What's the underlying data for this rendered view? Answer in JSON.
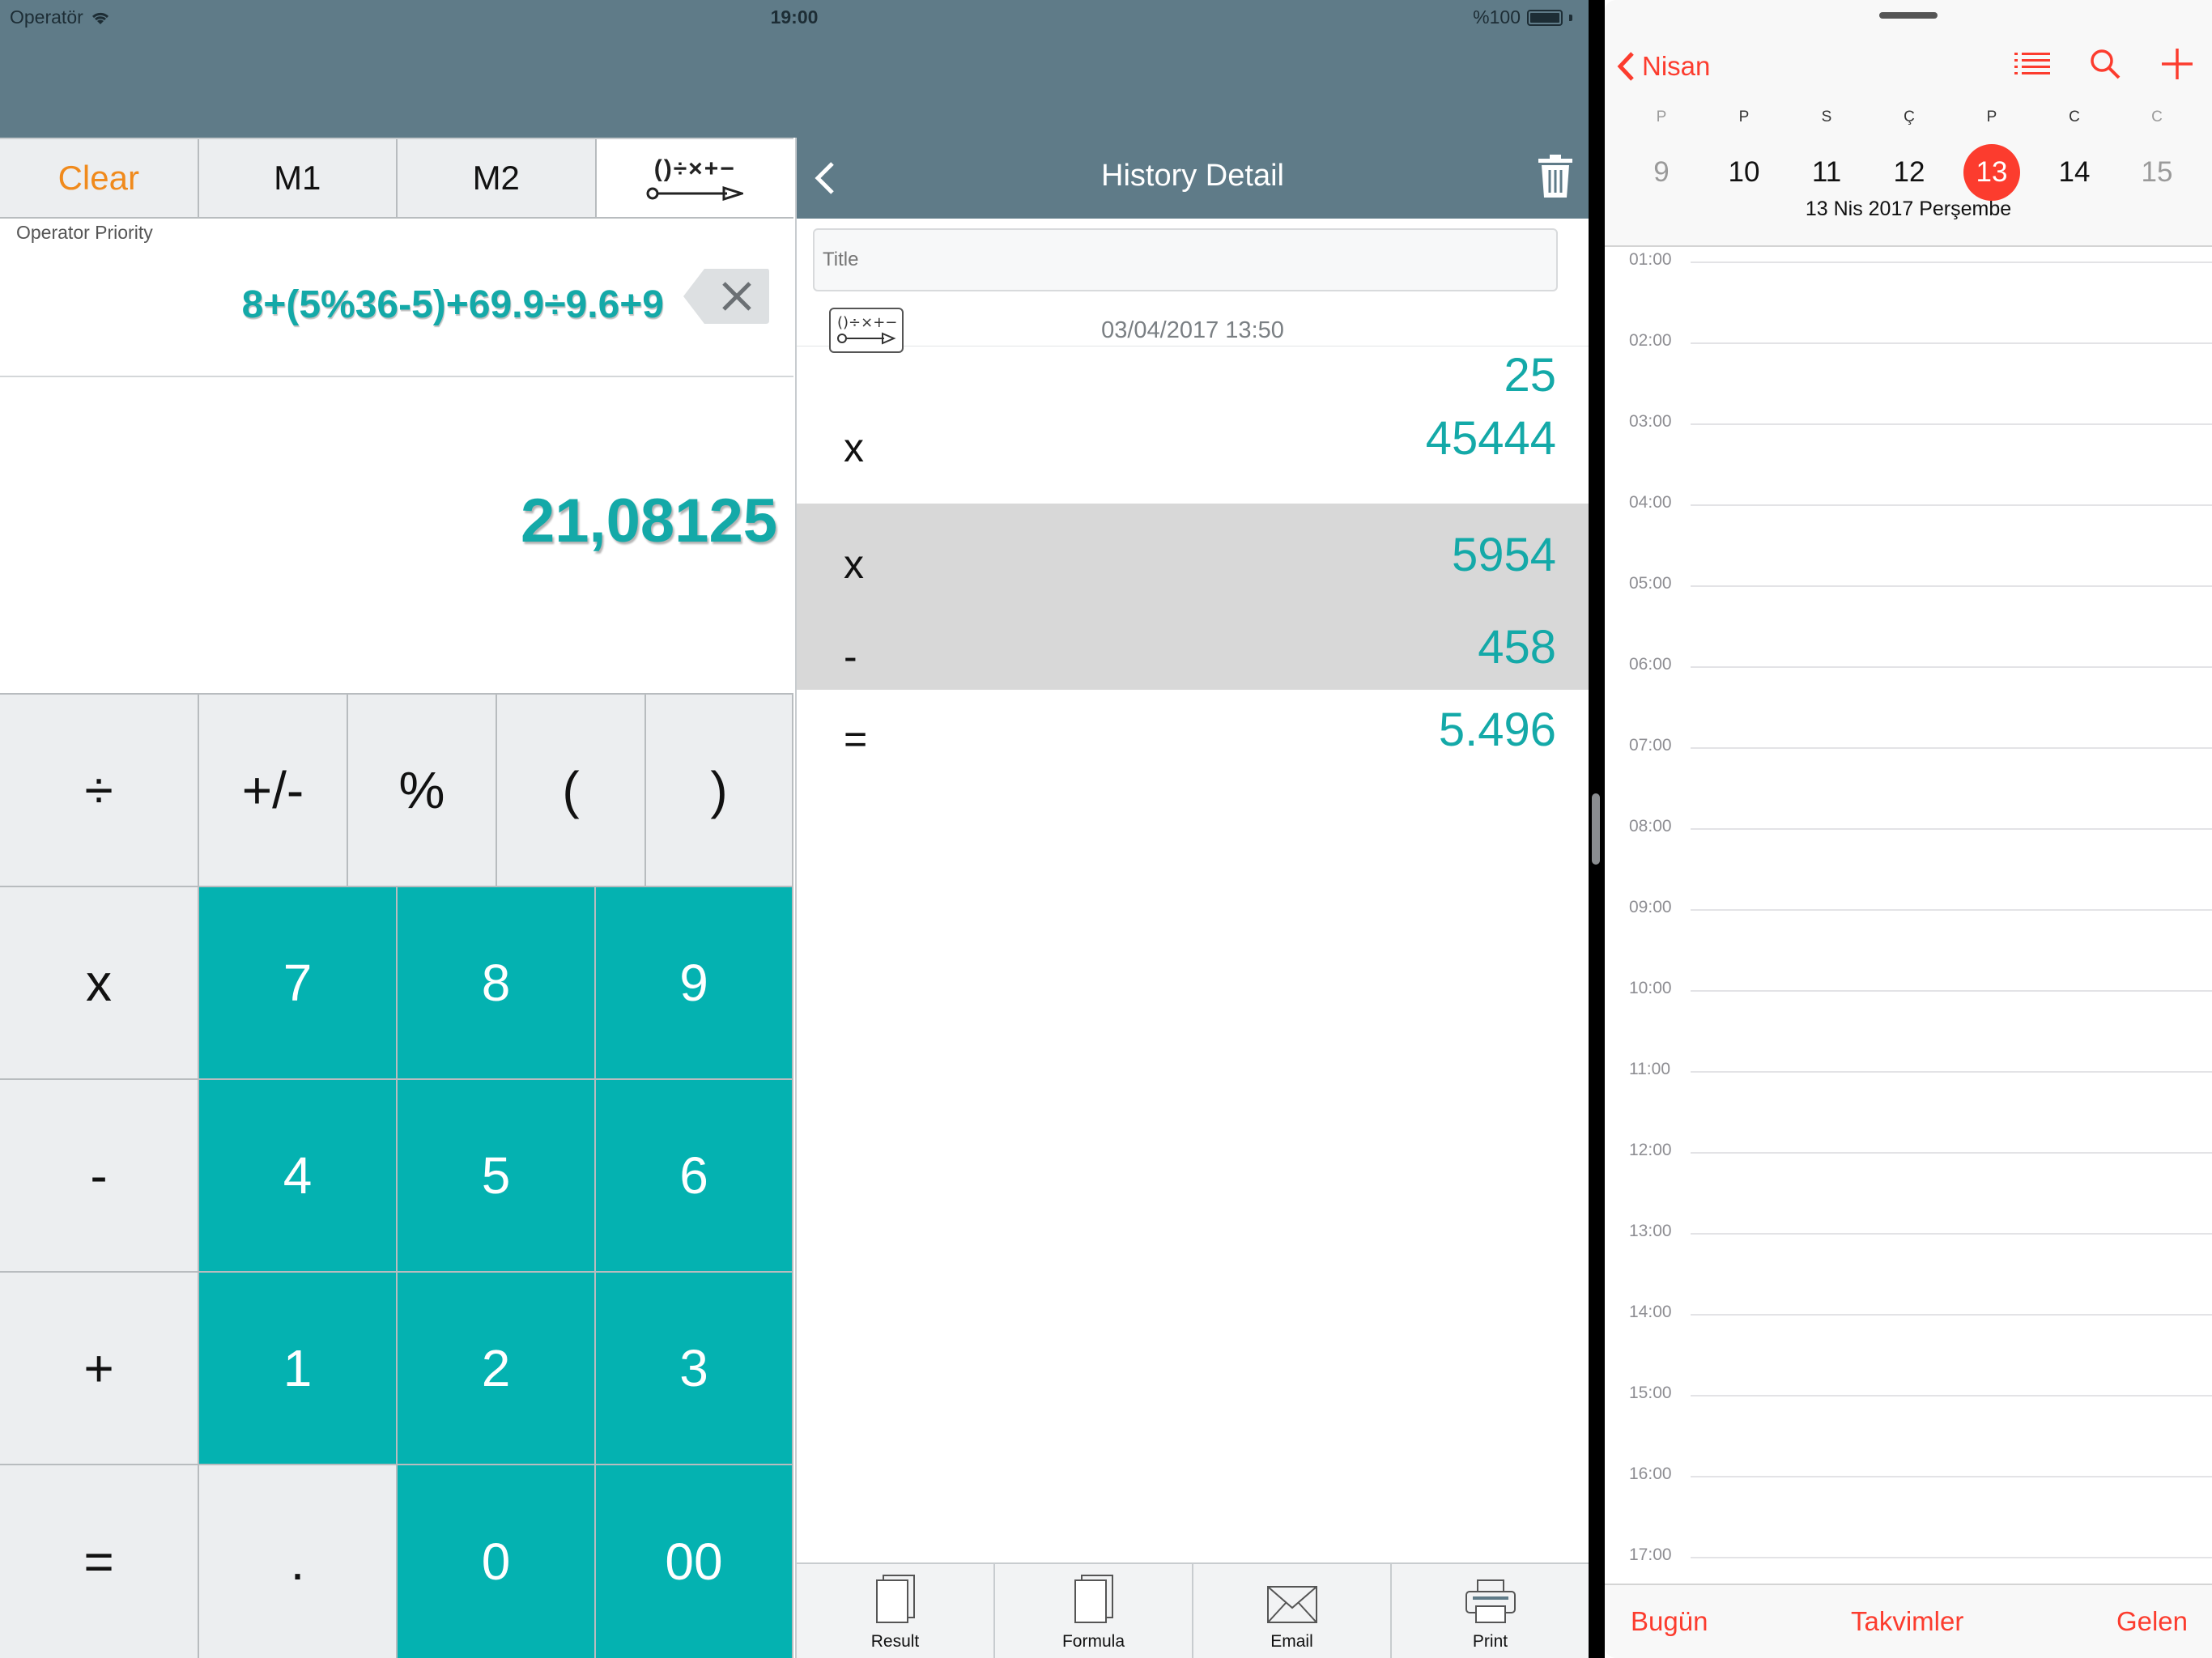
{
  "status_bar": {
    "carrier": "Operatör",
    "time": "19:00",
    "battery": "%100"
  },
  "calculator": {
    "tabs": [
      "Clear",
      "M1",
      "M2"
    ],
    "operator_icon_text": "()÷×+−",
    "mode_label": "Operator Priority",
    "expression": "8+(5%36-5)+69.9÷9.6+9",
    "result": "21,08125",
    "keys": {
      "divide": "÷",
      "plus_minus": "+/-",
      "percent": "%",
      "open_paren": "(",
      "close_paren": ")",
      "multiply": "x",
      "seven": "7",
      "eight": "8",
      "nine": "9",
      "minus": "-",
      "four": "4",
      "five": "5",
      "six": "6",
      "plus": "+",
      "one": "1",
      "two": "2",
      "three": "3",
      "equals": "=",
      "decimal": ".",
      "zero": "0",
      "double_zero": "00"
    }
  },
  "history": {
    "title": "History Detail",
    "title_placeholder": "Title",
    "meta_icon_text": "()÷×+−",
    "date": "03/04/2017 13:50",
    "rows": [
      {
        "op": "",
        "value": "25"
      },
      {
        "op": "x",
        "value": "45444"
      },
      {
        "op": "x",
        "value": "5954"
      },
      {
        "op": "-",
        "value": "458"
      },
      {
        "op": "=",
        "value": "5.496"
      }
    ],
    "toolbar": [
      "Result",
      "Formula",
      "Email",
      "Print"
    ]
  },
  "calendar": {
    "back_label": "Nisan",
    "weekdays": [
      "P",
      "P",
      "S",
      "Ç",
      "P",
      "C",
      "C"
    ],
    "days": [
      "9",
      "10",
      "11",
      "12",
      "13",
      "14",
      "15"
    ],
    "today_index": 4,
    "date_title": "13 Nis 2017 Perşembe",
    "hours": [
      "01:00",
      "02:00",
      "03:00",
      "04:00",
      "05:00",
      "06:00",
      "07:00",
      "08:00",
      "09:00",
      "10:00",
      "11:00",
      "12:00",
      "13:00",
      "14:00",
      "15:00",
      "16:00",
      "17:00"
    ],
    "tabbar": {
      "today": "Bugün",
      "calendars": "Takvimler",
      "inbox": "Gelen"
    },
    "accent_color": "#fc3c2e"
  },
  "colors": {
    "header": "#5f7b88",
    "teal_key": "#04b2b1",
    "teal_text": "#14a9a8",
    "clear_orange": "#f08a1c"
  }
}
